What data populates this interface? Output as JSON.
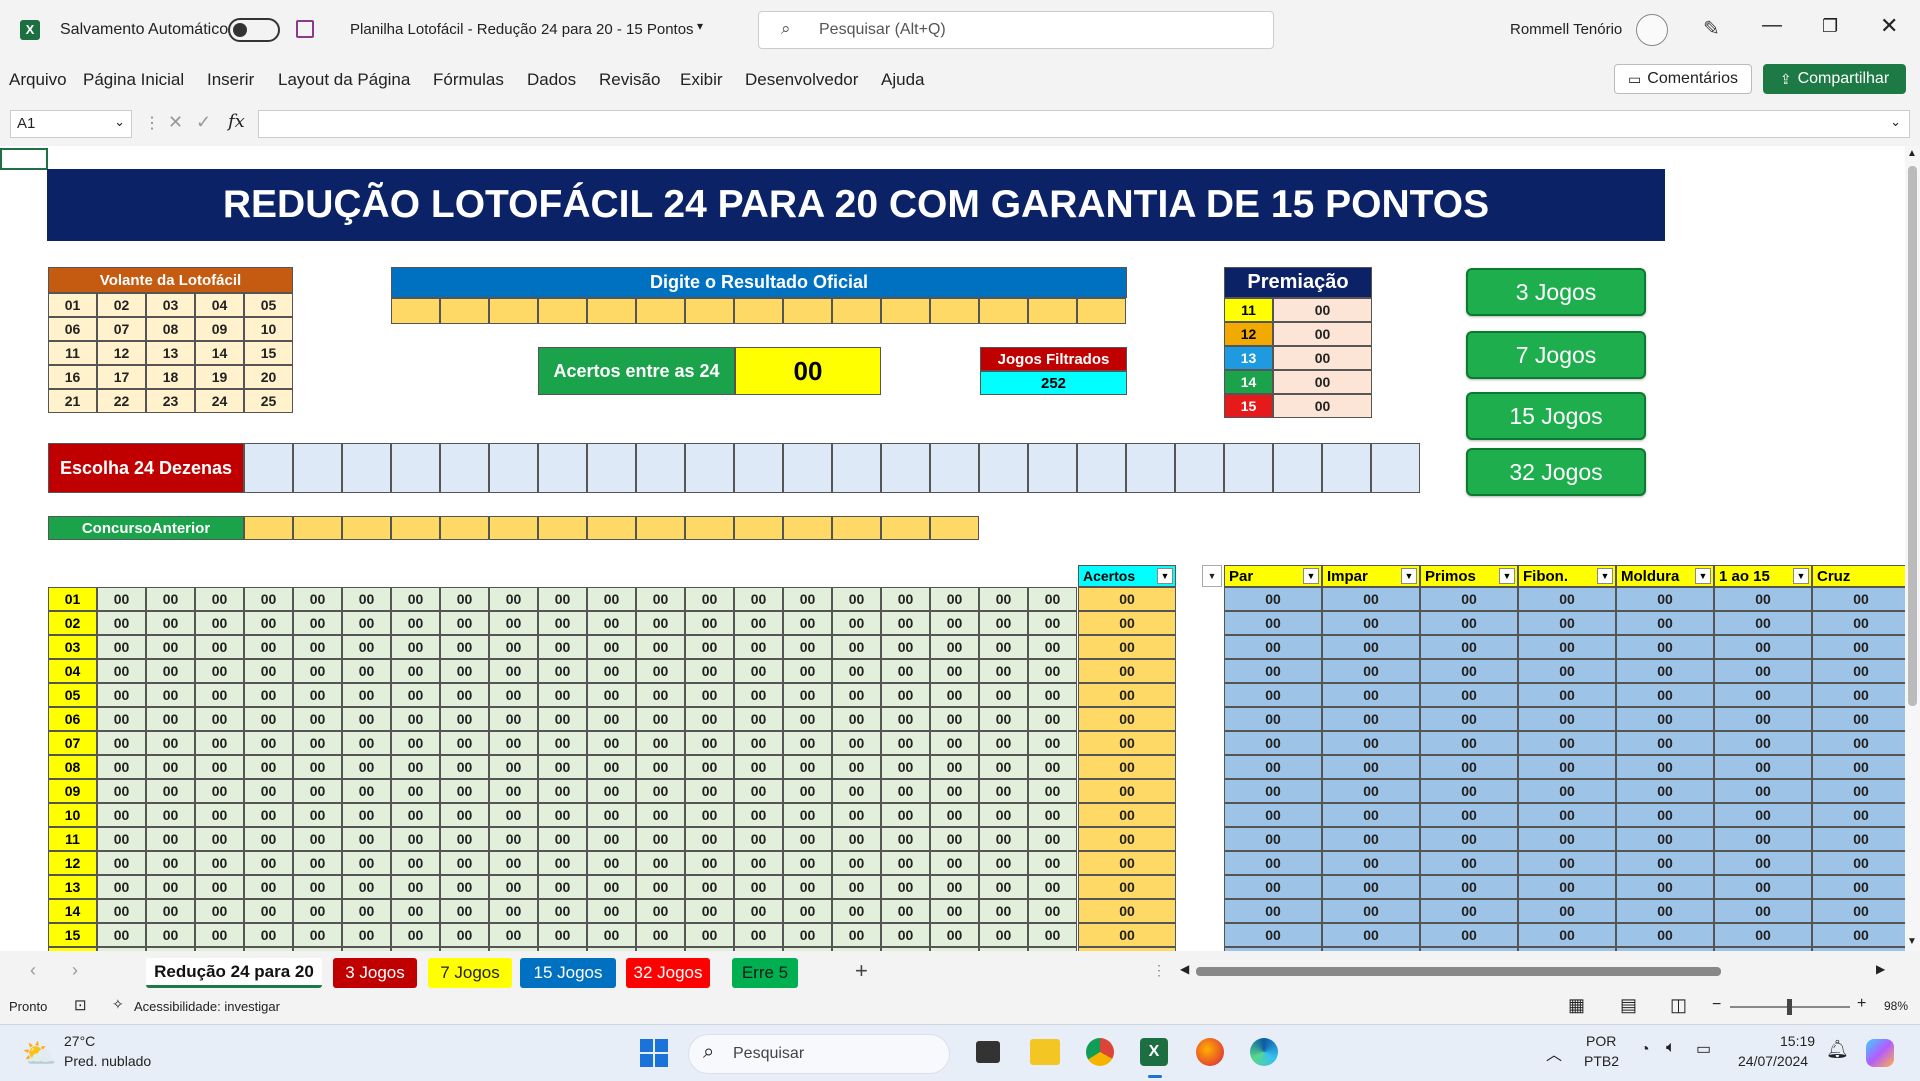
{
  "window": {
    "autosave_label": "Salvamento Automático",
    "doc_title": "Planilha Lotofácil - Redução 24 para 20 - 15 Pontos",
    "search_placeholder": "Pesquisar (Alt+Q)",
    "user_name": "Rommell Tenório"
  },
  "menu": {
    "items": [
      "Arquivo",
      "Página Inicial",
      "Inserir",
      "Layout da Página",
      "Fórmulas",
      "Dados",
      "Revisão",
      "Exibir",
      "Desenvolvedor",
      "Ajuda"
    ],
    "comments": "Comentários",
    "share": "Compartilhar"
  },
  "formula": {
    "name_box": "A1",
    "fx": "fx",
    "content": ""
  },
  "sheet": {
    "banner": "REDUÇÃO LOTOFÁCIL 24 PARA 20 COM GARANTIA DE 15 PONTOS",
    "volante_title": "Volante da Lotofácil",
    "volante_numbers": [
      [
        "01",
        "02",
        "03",
        "04",
        "05"
      ],
      [
        "06",
        "07",
        "08",
        "09",
        "10"
      ],
      [
        "11",
        "12",
        "13",
        "14",
        "15"
      ],
      [
        "16",
        "17",
        "18",
        "19",
        "20"
      ],
      [
        "21",
        "22",
        "23",
        "24",
        "25"
      ]
    ],
    "resultado_title": "Digite o Resultado Oficial",
    "acertos24_label": "Acertos entre as 24",
    "acertos24_value": "00",
    "filtrados_label": "Jogos Filtrados",
    "filtrados_value": "252",
    "premiacao_title": "Premiação",
    "premiacao": [
      {
        "pts": "11",
        "val": "00",
        "color": "#ffff00",
        "txt": "#000"
      },
      {
        "pts": "12",
        "val": "00",
        "color": "#f2a900",
        "txt": "#000"
      },
      {
        "pts": "13",
        "val": "00",
        "color": "#1e9be0",
        "txt": "#fff"
      },
      {
        "pts": "14",
        "val": "00",
        "color": "#1aa34a",
        "txt": "#fff"
      },
      {
        "pts": "15",
        "val": "00",
        "color": "#e51a1a",
        "txt": "#fff"
      }
    ],
    "jogos_buttons": [
      "3 Jogos",
      "7 Jogos",
      "15 Jogos",
      "32 Jogos"
    ],
    "escolha_label": "Escolha 24 Dezenas",
    "concurso_label": "ConcursoAnterior",
    "acertos_header": "Acertos",
    "filter_headers": [
      "Par",
      "Impar",
      "Primos",
      "Fibon.",
      "Moldura",
      "1 ao 15",
      "Cruz"
    ],
    "row_labels": [
      "01",
      "02",
      "03",
      "04",
      "05",
      "06",
      "07",
      "08",
      "09",
      "10",
      "11",
      "12",
      "13",
      "14",
      "15"
    ],
    "zero": "00"
  },
  "tabs": [
    {
      "label": "Redução 24 para 20",
      "bg": "#ffffff",
      "fg": "#1d5c2f",
      "active": true
    },
    {
      "label": "3 Jogos",
      "bg": "#c00000",
      "fg": "#ffffff"
    },
    {
      "label": "7 Jogos",
      "bg": "#ffff00",
      "fg": "#222222"
    },
    {
      "label": "15 Jogos",
      "bg": "#0070c0",
      "fg": "#ffffff"
    },
    {
      "label": "32 Jogos",
      "bg": "#ff0000",
      "fg": "#ffffff"
    },
    {
      "label": "Erre 5",
      "bg": "#00b050",
      "fg": "#1a1a1a"
    }
  ],
  "status": {
    "ready": "Pronto",
    "accessibility": "Acessibilidade: investigar",
    "zoom": "98%"
  },
  "taskbar": {
    "weather_temp": "27°C",
    "weather_desc": "Pred. nublado",
    "search": "Pesquisar",
    "lang1": "POR",
    "lang2": "PTB2",
    "time": "15:19",
    "date": "24/07/2024"
  }
}
